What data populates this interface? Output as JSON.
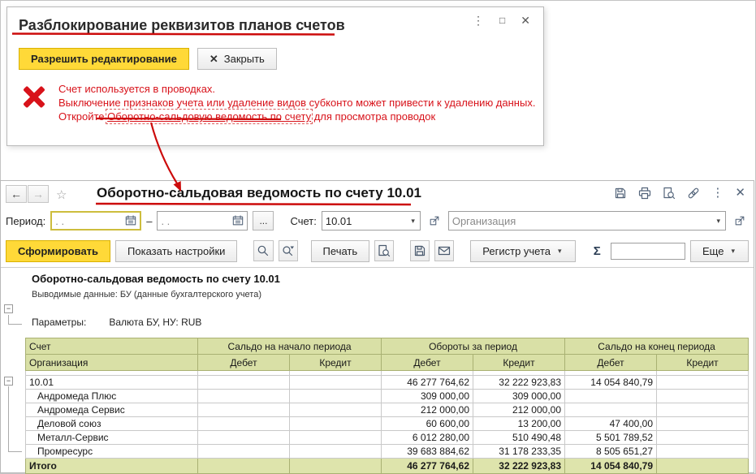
{
  "colors": {
    "accent_yellow": "#ffd938",
    "accent_yellow_border": "#d9b100",
    "error_red": "#d8121a",
    "annotation_red": "#cc0b0b",
    "table_header_green": "#d9e0a6",
    "table_total_green": "#dee4ac",
    "table_border": "#c9c9c9",
    "header_border": "#a9b173"
  },
  "dialog": {
    "title": "Разблокирование реквизитов планов счетов",
    "allow_edit_button": "Разрешить редактирование",
    "close_button": "Закрыть",
    "error": {
      "line1": "Счет используется в проводках.",
      "line2": "Выключение признаков учета или удаление видов субконто может привести к удалению данных.",
      "line3_prefix": "Откройте ",
      "line3_link": "Оборотно-сальдовую ведомость по счету",
      "line3_suffix": " для просмотра проводок"
    }
  },
  "report_window": {
    "title": "Оборотно-сальдовая ведомость по счету 10.01",
    "filters": {
      "period_label": "Период:",
      "period_from": ".  .",
      "period_to": ".  .",
      "range_dash": "–",
      "ellipsis_button": "...",
      "account_label": "Счет:",
      "account_value": "10.01",
      "organization_placeholder": "Организация"
    },
    "toolbar": {
      "generate": "Сформировать",
      "settings": "Показать настройки",
      "print": "Печать",
      "register": "Регистр учета",
      "more": "Еще"
    },
    "sheet": {
      "title": "Оборотно-сальдовая ведомость по счету 10.01",
      "output_line": "Выводимые данные: БУ (данные бухгалтерского учета)",
      "params_label": "Параметры:",
      "params_value": "Валюта БУ, НУ: RUB",
      "table": {
        "col_headers": {
          "account": "Счет",
          "organization": "Организация",
          "opening": "Сальдо на начало периода",
          "turnover": "Обороты за период",
          "closing": "Сальдо на конец периода",
          "debit": "Дебет",
          "credit": "Кредит"
        },
        "rows": [
          {
            "name": "10.01",
            "indent": 0,
            "values": [
              "",
              "",
              "46 277 764,62",
              "32 222 923,83",
              "14 054 840,79",
              ""
            ]
          },
          {
            "name": "Андромеда Плюс",
            "indent": 1,
            "values": [
              "",
              "",
              "309 000,00",
              "309 000,00",
              "",
              ""
            ]
          },
          {
            "name": "Андромеда Сервис",
            "indent": 1,
            "values": [
              "",
              "",
              "212 000,00",
              "212 000,00",
              "",
              ""
            ]
          },
          {
            "name": "Деловой союз",
            "indent": 1,
            "values": [
              "",
              "",
              "60 600,00",
              "13 200,00",
              "47 400,00",
              ""
            ]
          },
          {
            "name": "Металл-Сервис",
            "indent": 1,
            "values": [
              "",
              "",
              "6 012 280,00",
              "510 490,48",
              "5 501 789,52",
              ""
            ]
          },
          {
            "name": "Промресурс",
            "indent": 1,
            "values": [
              "",
              "",
              "39 683 884,62",
              "31 178 233,35",
              "8 505 651,27",
              ""
            ]
          }
        ],
        "total_row": {
          "name": "Итого",
          "values": [
            "",
            "",
            "46 277 764,62",
            "32 222 923,83",
            "14 054 840,79",
            ""
          ]
        }
      }
    }
  }
}
